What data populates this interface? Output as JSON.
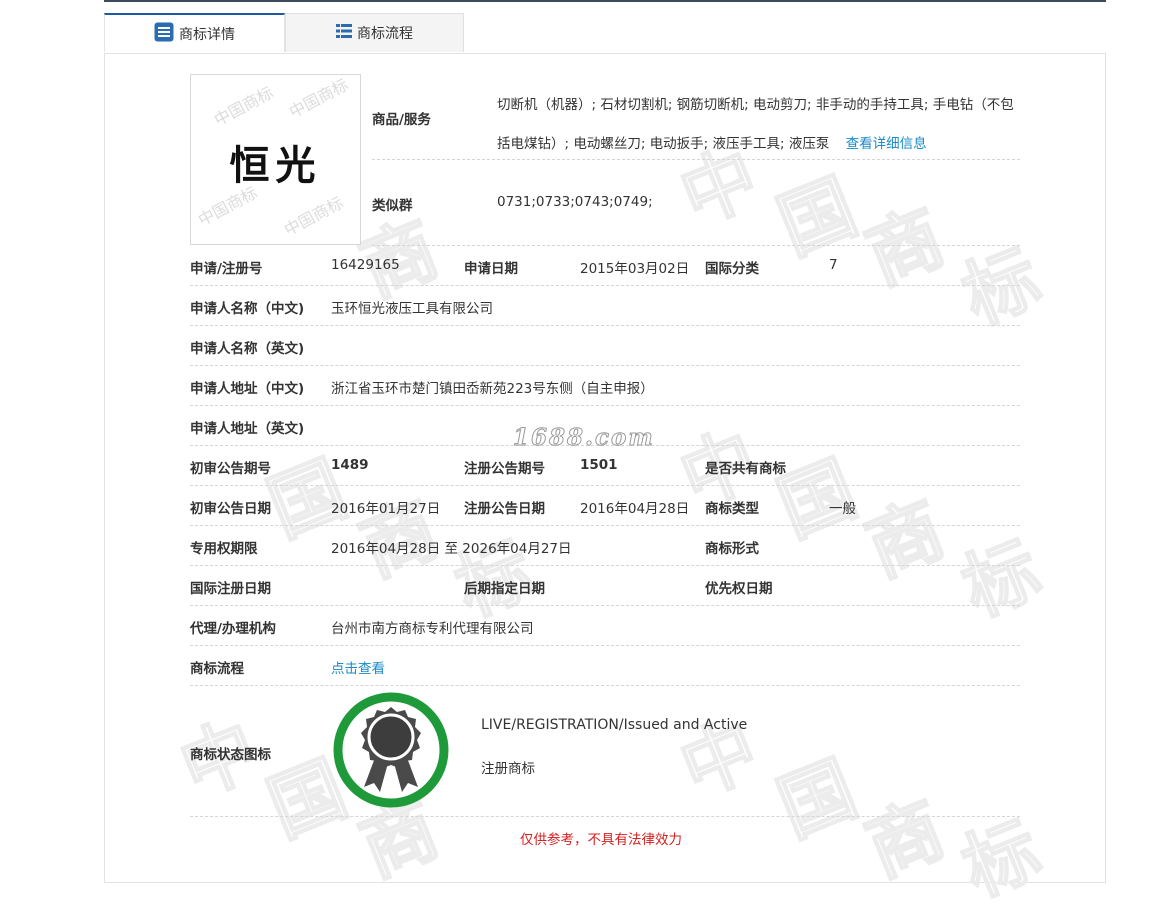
{
  "tabs": [
    {
      "label": "商标详情",
      "icon": "list-icon",
      "active": true
    },
    {
      "label": "商标流程",
      "icon": "grid-list-icon",
      "active": false
    }
  ],
  "logo": {
    "text": "恒光",
    "watermark": "中国商标"
  },
  "goods": {
    "label": "商品/服务",
    "value": "切断机（机器）; 石材切割机; 钢筋切断机; 电动剪刀; 非手动的手持工具; 手电钻（不包括电煤钻）; 电动螺丝刀; 电动扳手; 液压手工具; 液压泵",
    "more_link": "查看详细信息"
  },
  "similar_group": {
    "label": "类似群",
    "value": "0731;0733;0743;0749;"
  },
  "rows": {
    "reg_no": {
      "label": "申请/注册号",
      "value": "16429165"
    },
    "apply_date": {
      "label": "申请日期",
      "value": "2015年03月02日"
    },
    "intl_class": {
      "label": "国际分类",
      "value": "7"
    },
    "applicant_cn": {
      "label": "申请人名称（中文)",
      "value": "玉环恒光液压工具有限公司"
    },
    "applicant_en": {
      "label": "申请人名称（英文)",
      "value": ""
    },
    "address_cn": {
      "label": "申请人地址（中文)",
      "value": "浙江省玉环市楚门镇田岙新苑223号东侧（自主申报）"
    },
    "address_en": {
      "label": "申请人地址（英文)",
      "value": ""
    },
    "prelim_issue": {
      "label": "初审公告期号",
      "value": "1489"
    },
    "reg_issue": {
      "label": "注册公告期号",
      "value": "1501"
    },
    "shared": {
      "label": "是否共有商标",
      "value": ""
    },
    "prelim_date": {
      "label": "初审公告日期",
      "value": "2016年01月27日"
    },
    "reg_date": {
      "label": "注册公告日期",
      "value": "2016年04月28日"
    },
    "tm_type": {
      "label": "商标类型",
      "value": "一般"
    },
    "validity": {
      "label": "专用权期限",
      "value": "2016年04月28日 至 2026年04月27日"
    },
    "tm_form": {
      "label": "商标形式",
      "value": ""
    },
    "intl_reg_date": {
      "label": "国际注册日期",
      "value": ""
    },
    "later_date": {
      "label": "后期指定日期",
      "value": ""
    },
    "priority_date": {
      "label": "优先权日期",
      "value": ""
    },
    "agent": {
      "label": "代理/办理机构",
      "value": "台州市南方商标专利代理有限公司"
    },
    "flow": {
      "label": "商标流程",
      "value": "点击查看"
    },
    "status": {
      "label": "商标状态图标",
      "status_en": "LIVE/REGISTRATION/Issued and Active",
      "status_cn": "注册商标"
    }
  },
  "site_watermark": "1688.com",
  "disclaimer": "仅供参考，不具有法律效力",
  "colors": {
    "link": "#1a8bc9",
    "tab_accent": "#1e5aa0",
    "seal_ring": "#1f9a3a",
    "seal_badge": "#4a4a4a",
    "disclaimer": "#d62020"
  }
}
